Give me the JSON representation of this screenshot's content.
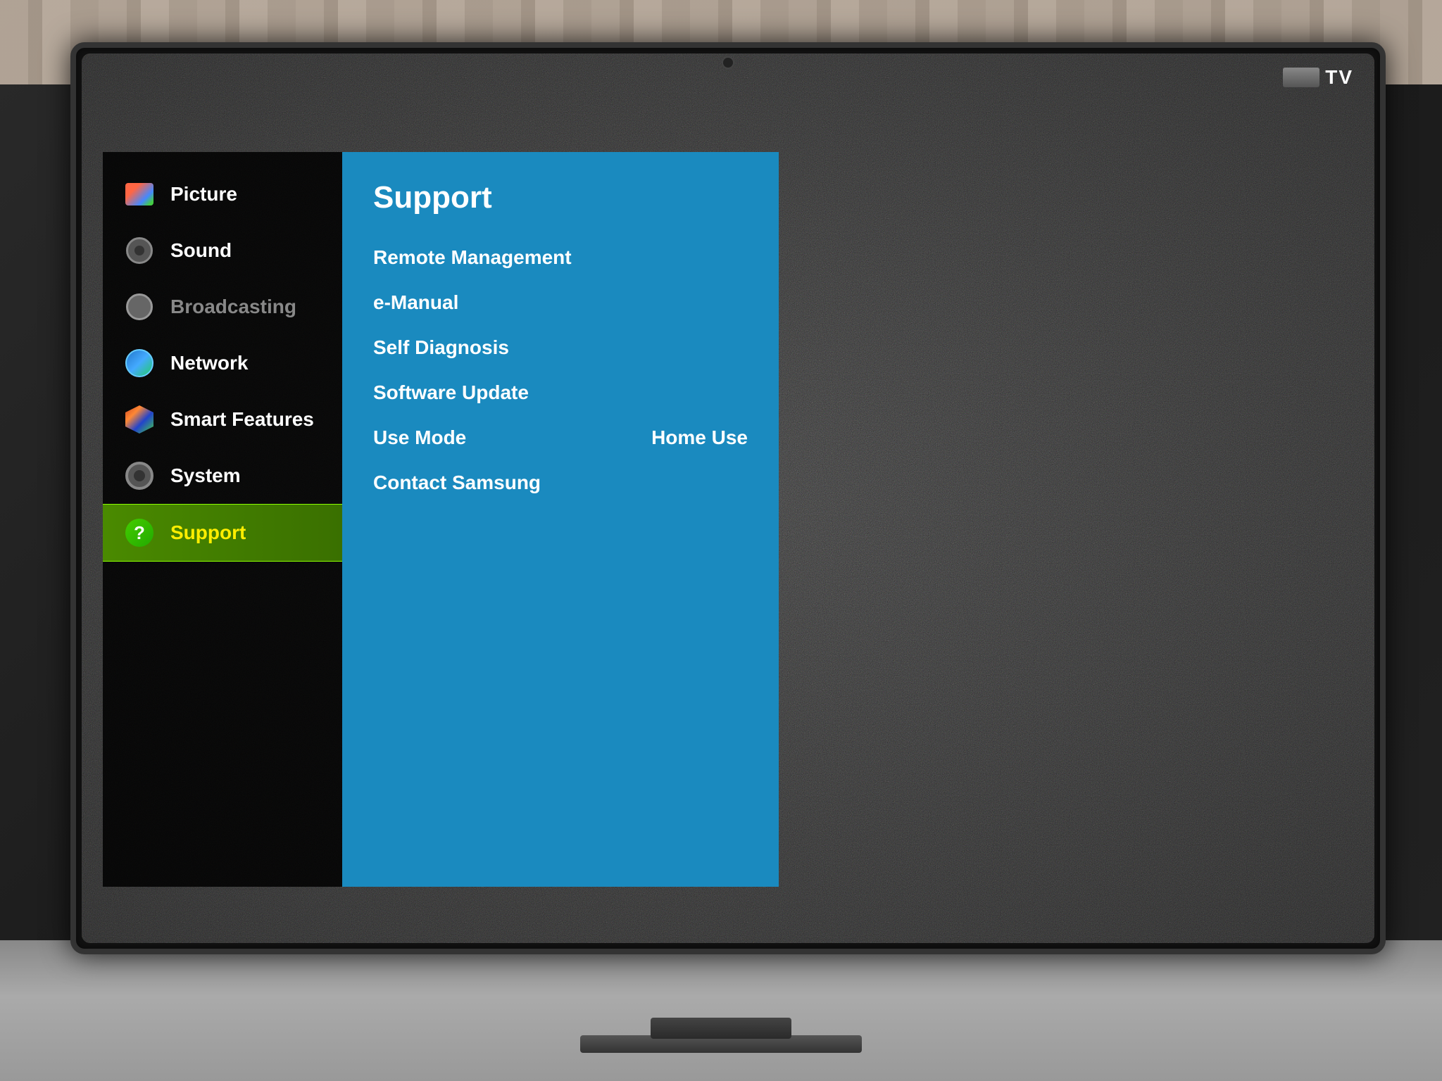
{
  "tv": {
    "label": "TV",
    "camera": "camera"
  },
  "sidebar": {
    "items": [
      {
        "id": "picture",
        "label": "Picture",
        "icon": "picture-icon",
        "state": "normal"
      },
      {
        "id": "sound",
        "label": "Sound",
        "icon": "sound-icon",
        "state": "normal"
      },
      {
        "id": "broadcasting",
        "label": "Broadcasting",
        "icon": "broadcasting-icon",
        "state": "dimmed"
      },
      {
        "id": "network",
        "label": "Network",
        "icon": "network-icon",
        "state": "normal"
      },
      {
        "id": "smart-features",
        "label": "Smart Features",
        "icon": "smart-icon",
        "state": "normal"
      },
      {
        "id": "system",
        "label": "System",
        "icon": "system-icon",
        "state": "normal"
      },
      {
        "id": "support",
        "label": "Support",
        "icon": "support-icon",
        "state": "active"
      }
    ]
  },
  "panel": {
    "title": "Support",
    "menu_items": [
      {
        "id": "remote-management",
        "label": "Remote Management",
        "value": ""
      },
      {
        "id": "e-manual",
        "label": "e-Manual",
        "value": ""
      },
      {
        "id": "self-diagnosis",
        "label": "Self Diagnosis",
        "value": ""
      },
      {
        "id": "software-update",
        "label": "Software Update",
        "value": ""
      },
      {
        "id": "use-mode",
        "label": "Use Mode",
        "value": "Home Use"
      },
      {
        "id": "contact-samsung",
        "label": "Contact Samsung",
        "value": ""
      }
    ]
  }
}
